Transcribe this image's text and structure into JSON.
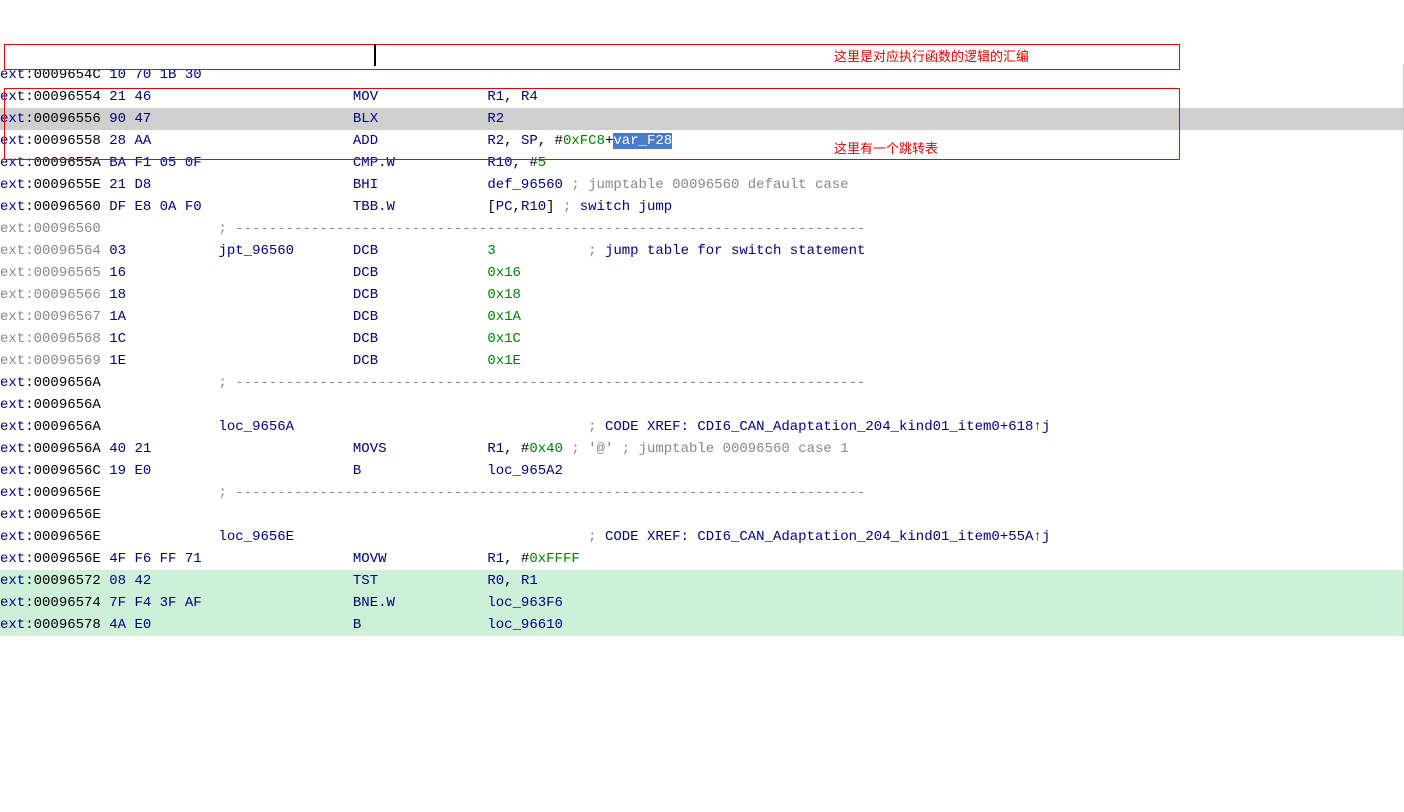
{
  "annotations": {
    "a1": "这里是对应执行函数的逻辑的汇编",
    "a2": "这里有一个跳转表"
  },
  "lines": [
    {
      "seg": "ext",
      "addr": "0009654C",
      "addrColor": "dark",
      "bytes": "10 70 1B 30",
      "label": "",
      "mn": "",
      "ops": "",
      "comment": "",
      "bg": ""
    },
    {
      "seg": "ext",
      "addr": "00096554",
      "addrColor": "dark",
      "bytes": "21 46",
      "label": "",
      "mn": "MOV",
      "ops": [
        [
          "op",
          "R1"
        ],
        [
          "plain",
          ", "
        ],
        [
          "op",
          "R4"
        ]
      ],
      "comment": "",
      "bg": ""
    },
    {
      "seg": "ext",
      "addr": "00096556",
      "addrColor": "dark",
      "bytes": "90 47",
      "label": "",
      "mn": "BLX",
      "ops": [
        [
          "op",
          "R2"
        ]
      ],
      "comment": "",
      "bg": "gray"
    },
    {
      "seg": "ext",
      "addr": "00096558",
      "addrColor": "dark",
      "bytes": "28 AA",
      "label": "",
      "mn": "ADD",
      "ops": [
        [
          "op",
          "R2"
        ],
        [
          "plain",
          ", "
        ],
        [
          "op",
          "SP"
        ],
        [
          "plain",
          ", #"
        ],
        [
          "imm",
          "0xFC8"
        ],
        [
          "plain",
          "+"
        ],
        [
          "sel",
          "var_F28"
        ]
      ],
      "comment": "",
      "bg": ""
    },
    {
      "seg": "ext",
      "addr": "0009655A",
      "addrColor": "dark",
      "bytes": "BA F1 05 0F",
      "label": "",
      "mn": "CMP.W",
      "ops": [
        [
          "op",
          "R10"
        ],
        [
          "plain",
          ", #"
        ],
        [
          "imm",
          "5"
        ]
      ],
      "comment": "",
      "bg": ""
    },
    {
      "seg": "ext",
      "addr": "0009655E",
      "addrColor": "dark",
      "bytes": "21 D8",
      "label": "",
      "mn": "BHI",
      "ops": [
        [
          "op",
          "def_96560"
        ]
      ],
      "comment": [
        [
          "gray",
          " ; jumptable 00096560 default case"
        ]
      ],
      "bg": ""
    },
    {
      "seg": "ext",
      "addr": "00096560",
      "addrColor": "dark",
      "bytes": "DF E8 0A F0",
      "label": "",
      "mn": "TBB.W",
      "ops": [
        [
          "plain",
          "["
        ],
        [
          "op",
          "PC"
        ],
        [
          "plain",
          ","
        ],
        [
          "op",
          "R10"
        ],
        [
          "plain",
          "]"
        ]
      ],
      "comment": [
        [
          "gray",
          " ; "
        ],
        [
          "blue",
          "switch jump"
        ]
      ],
      "bg": ""
    },
    {
      "seg": "ext",
      "addr": "00096560",
      "addrColor": "gray",
      "bytes": "",
      "label": "",
      "mn": "",
      "ops": "",
      "comment": [
        [
          "gray",
          "; ---------------------------------------------------------------------------"
        ]
      ],
      "bg": "",
      "commentCol": "label"
    },
    {
      "seg": "ext",
      "addr": "00096564",
      "addrColor": "gray",
      "bytes": "03",
      "label": "jpt_96560",
      "mn": "DCB",
      "ops": [
        [
          "imm",
          "3"
        ]
      ],
      "comment": [
        [
          "gray",
          "; "
        ],
        [
          "blue",
          "jump table for switch statement"
        ]
      ],
      "commentIndent": "wide",
      "bg": ""
    },
    {
      "seg": "ext",
      "addr": "00096565",
      "addrColor": "gray",
      "bytes": "16",
      "label": "",
      "mn": "DCB",
      "ops": [
        [
          "imm",
          "0x16"
        ]
      ],
      "comment": "",
      "bg": ""
    },
    {
      "seg": "ext",
      "addr": "00096566",
      "addrColor": "gray",
      "bytes": "18",
      "label": "",
      "mn": "DCB",
      "ops": [
        [
          "imm",
          "0x18"
        ]
      ],
      "comment": "",
      "bg": ""
    },
    {
      "seg": "ext",
      "addr": "00096567",
      "addrColor": "gray",
      "bytes": "1A",
      "label": "",
      "mn": "DCB",
      "ops": [
        [
          "imm",
          "0x1A"
        ]
      ],
      "comment": "",
      "bg": ""
    },
    {
      "seg": "ext",
      "addr": "00096568",
      "addrColor": "gray",
      "bytes": "1C",
      "label": "",
      "mn": "DCB",
      "ops": [
        [
          "imm",
          "0x1C"
        ]
      ],
      "comment": "",
      "bg": ""
    },
    {
      "seg": "ext",
      "addr": "00096569",
      "addrColor": "gray",
      "bytes": "1E",
      "label": "",
      "mn": "DCB",
      "ops": [
        [
          "imm",
          "0x1E"
        ]
      ],
      "comment": "",
      "bg": ""
    },
    {
      "seg": "ext",
      "addr": "0009656A",
      "addrColor": "dark",
      "bytes": "",
      "label": "",
      "mn": "",
      "ops": "",
      "comment": [
        [
          "gray",
          "; ---------------------------------------------------------------------------"
        ]
      ],
      "bg": "",
      "commentCol": "label"
    },
    {
      "seg": "ext",
      "addr": "0009656A",
      "addrColor": "dark",
      "bytes": "",
      "label": "",
      "mn": "",
      "ops": "",
      "comment": "",
      "bg": ""
    },
    {
      "seg": "ext",
      "addr": "0009656A",
      "addrColor": "dark",
      "bytes": "",
      "label": "loc_9656A",
      "mn": "",
      "ops": "",
      "comment": [
        [
          "gray",
          "; "
        ],
        [
          "blue",
          "CODE XREF: CDI6_CAN_Adaptation_204_kind01_item0+618↑j"
        ]
      ],
      "commentIndent": "wide",
      "bg": ""
    },
    {
      "seg": "ext",
      "addr": "0009656A",
      "addrColor": "dark",
      "bytes": "40 21",
      "label": "",
      "mn": "MOVS",
      "ops": [
        [
          "op",
          "R1"
        ],
        [
          "plain",
          ", #"
        ],
        [
          "imm",
          "0x40"
        ]
      ],
      "comment": [
        [
          "gray",
          " ; '@' ; jumptable 00096560 case 1"
        ]
      ],
      "bg": ""
    },
    {
      "seg": "ext",
      "addr": "0009656C",
      "addrColor": "dark",
      "bytes": "19 E0",
      "label": "",
      "mn": "B",
      "ops": [
        [
          "op",
          "loc_965A2"
        ]
      ],
      "comment": "",
      "bg": ""
    },
    {
      "seg": "ext",
      "addr": "0009656E",
      "addrColor": "dark",
      "bytes": "",
      "label": "",
      "mn": "",
      "ops": "",
      "comment": [
        [
          "gray",
          "; ---------------------------------------------------------------------------"
        ]
      ],
      "bg": "",
      "commentCol": "label"
    },
    {
      "seg": "ext",
      "addr": "0009656E",
      "addrColor": "dark",
      "bytes": "",
      "label": "",
      "mn": "",
      "ops": "",
      "comment": "",
      "bg": ""
    },
    {
      "seg": "ext",
      "addr": "0009656E",
      "addrColor": "dark",
      "bytes": "",
      "label": "loc_9656E",
      "mn": "",
      "ops": "",
      "comment": [
        [
          "gray",
          "; "
        ],
        [
          "blue",
          "CODE XREF: CDI6_CAN_Adaptation_204_kind01_item0+55A↑j"
        ]
      ],
      "commentIndent": "wide",
      "bg": ""
    },
    {
      "seg": "ext",
      "addr": "0009656E",
      "addrColor": "dark",
      "bytes": "4F F6 FF 71",
      "label": "",
      "mn": "MOVW",
      "ops": [
        [
          "op",
          "R1"
        ],
        [
          "plain",
          ", #"
        ],
        [
          "imm",
          "0xFFFF"
        ]
      ],
      "comment": "",
      "bg": ""
    },
    {
      "seg": "ext",
      "addr": "00096572",
      "addrColor": "dark",
      "bytes": "08 42",
      "label": "",
      "mn": "TST",
      "ops": [
        [
          "op",
          "R0"
        ],
        [
          "plain",
          ", "
        ],
        [
          "op",
          "R1"
        ]
      ],
      "comment": "",
      "bg": "green"
    },
    {
      "seg": "ext",
      "addr": "00096574",
      "addrColor": "dark",
      "bytes": "7F F4 3F AF",
      "label": "",
      "mn": "BNE.W",
      "ops": [
        [
          "op",
          "loc_963F6"
        ]
      ],
      "comment": "",
      "bg": "green"
    },
    {
      "seg": "ext",
      "addr": "00096578",
      "addrColor": "dark",
      "bytes": "4A E0",
      "label": "",
      "mn": "B",
      "ops": [
        [
          "op",
          "loc_96610"
        ]
      ],
      "comment": "",
      "bg": "green"
    }
  ],
  "cols": {
    "seg": 0,
    "addr": 4,
    "bytes": 13,
    "label": 26,
    "mn": 42,
    "ops": 58,
    "comment_wide": 70
  }
}
